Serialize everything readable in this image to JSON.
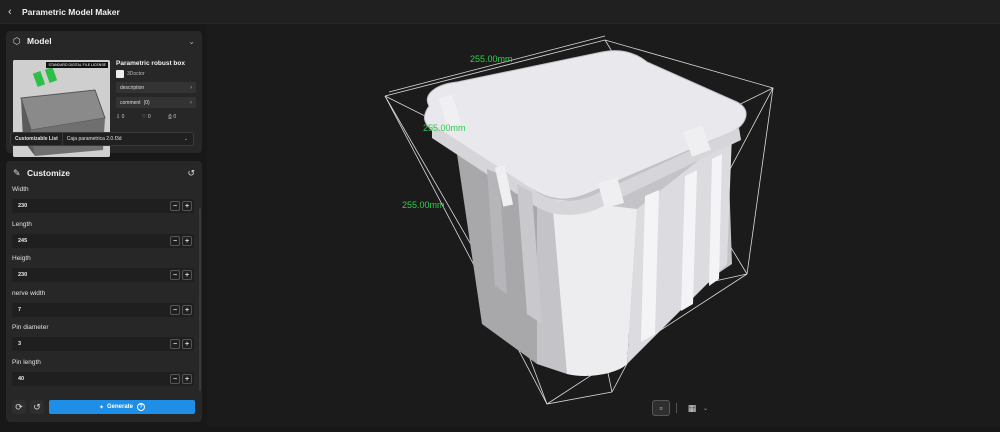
{
  "app": {
    "title": "Parametric Model Maker",
    "back_icon": "chevron-left-icon"
  },
  "model": {
    "section_title": "Model",
    "thumbnail_tag": "STANDARD DIGITAL FILE LICENSE",
    "name": "Parametric robust box",
    "author": "3Doctor",
    "description_label": "description",
    "comment_label": "comment",
    "comment_count": "(0)",
    "stats": {
      "downloads": "0",
      "likes": "0",
      "prints": "0"
    },
    "customizable_list_label": "Customizable List",
    "customizable_list_value": "Caja parametrica 2.0.f3d"
  },
  "customize": {
    "section_title": "Customize",
    "params": [
      {
        "label": "Width",
        "value": "230"
      },
      {
        "label": "Length",
        "value": "245"
      },
      {
        "label": "Heigth",
        "value": "230"
      },
      {
        "label": "nerve width",
        "value": "7"
      },
      {
        "label": "Pin diameter",
        "value": "3"
      },
      {
        "label": "Pin length",
        "value": "40"
      }
    ],
    "minus": "−",
    "plus": "+",
    "generate_label": "Generate"
  },
  "viewport": {
    "dim_top": "255.00mm",
    "dim_mid": "255.00mm",
    "dim_left": "255.00mm",
    "dim_color": "#2bd14a"
  },
  "colors": {
    "accent": "#1f8ee6",
    "panel": "#272727",
    "background": "#181818"
  }
}
